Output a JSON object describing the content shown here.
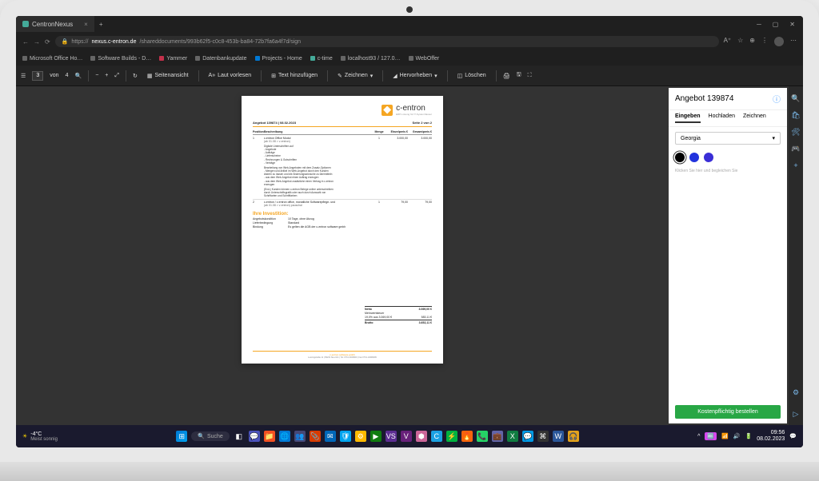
{
  "browser": {
    "tab_title": "CentronNexus",
    "url_prefix": "https://",
    "url_host": "nexus.c-entron.de",
    "url_path": "/shareddocuments/993b62f5-c0c8-453b-ba84-72b7fa6a4f7d/sign",
    "bookmarks": [
      "Microsoft Office Ho…",
      "Software Builds - D…",
      "Yammer",
      "Datenbankupdate",
      "Projects - Home",
      "c-time",
      "localhost93 / 127.0…",
      "WebOffer"
    ]
  },
  "toolbar": {
    "page_current": "3",
    "page_sep": "von",
    "page_total": "4",
    "seitenansicht": "Seitenansicht",
    "laut_vorlesen": "Laut vorlesen",
    "text_hinzu": "Text hinzufügen",
    "zeichnen": "Zeichnen",
    "hervorheben": "Hervorheben",
    "loeschen": "Löschen"
  },
  "doc": {
    "logo_name": "c-entron",
    "logo_sub": "ERP-Lösung für IT-Systemhäuser",
    "header_left": "Angebot 139874 | 08.02.2023",
    "header_right": "Seite 2 von 2",
    "th_pos": "Position",
    "th_desc": "Beschreibung",
    "th_qty": "Menge",
    "th_unit": "Einzelpreis €",
    "th_total": "Gesamtpreis €",
    "l1_pos": "1",
    "l1_desc": "c-entron Office Modul",
    "l1_sub": "(ab 01.08 > v-entron)",
    "l1_qty": "1",
    "l1_unit": "3.000,00",
    "l1_total": "3.000,00",
    "block1": "Digitale Unterschriften auf\n- Angebote\n- Aufträge\n- Lieferscheine\n- Rechnungen & Gutschriften\n- Verträge",
    "block2": "Bearbeitung von Web-Angeboten mit dem Zusatz-Optionen\n- Mengen und Artikel im Web-Angebot durch den Kunden\nändern zu lassen und die Änderungswünsche zu übermitteln\n- aus dem Web-Angebot einen Auftrag erzeugen\n- aus dem Web-Angebot zusätzliche einen Vertrag in c-entron\nerzeugen",
    "block3": "(End-) Kunden können c-entron Belege online unterschreiben\ndurch Unterschriftsgrafik oder auch durch Auswahl von\nSchriftarten und Schriftfarben",
    "l2_pos": "2",
    "l2_desc": "c-entron / v-entron office, monatliche Softwarepflege- und",
    "l2_sub": "(ab 01.08 > v-entron) pauschal",
    "l2_qty": "1",
    "l2_unit": "79,00",
    "l2_total": "79,00",
    "invest_title": "Ihre Investition:",
    "ik1": "Angebotskondition",
    "iv1": "10 Tage, ohne Abzug",
    "ik2": "Lieferbedingung",
    "iv2": "Standard",
    "ik3": "Bindung",
    "iv3": "Es gelten die AGB der c-entron software gmbh",
    "tot_netto_l": "Netto",
    "tot_netto_v": "3.069,00 €",
    "tot_mwst_l": "Mehrwertsteuer",
    "tot_mwst_v": "",
    "tot_mwst2_l": "19,0% aus 3.069,00 €",
    "tot_mwst2_v": "583,11 €",
    "tot_brutto_l": "Brutto",
    "tot_brutto_v": "3.652,11 €",
    "footer_company": "c-entron software gmbh",
    "footer_addr": "Lessingstraße 11 | 89231 Neu-Ulm | Tel. 0731-1460600 | Fax 0731-14606099"
  },
  "sign": {
    "title": "Angebot 139874",
    "tab_eingeben": "Eingeben",
    "tab_hochladen": "Hochladen",
    "tab_zeichnen": "Zeichnen",
    "font": "Georgia",
    "placeholder": "Klicken Sie hier und begleichen Sie",
    "order_btn": "Kostenpflichtig bestellen",
    "colors": [
      "#000000",
      "#2233dd",
      "#3a2ed6"
    ]
  },
  "taskbar": {
    "temp": "-4°C",
    "weather": "Meist sonnig",
    "search": "Suche",
    "time": "09:56",
    "date": "08.02.2023"
  }
}
